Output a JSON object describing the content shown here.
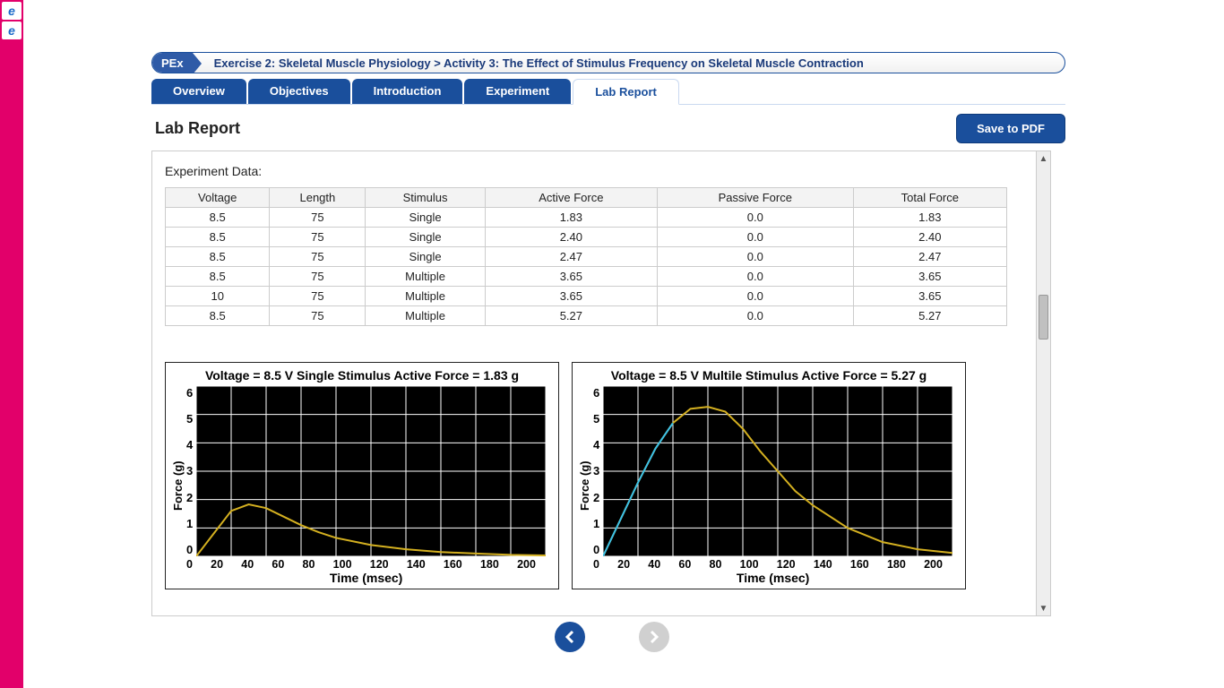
{
  "breadcrumb": {
    "badge": "PEx",
    "text": "Exercise 2: Skeletal Muscle Physiology > Activity 3: The Effect of Stimulus Frequency on Skeletal Muscle Contraction"
  },
  "tabs": {
    "overview": "Overview",
    "objectives": "Objectives",
    "introduction": "Introduction",
    "experiment": "Experiment",
    "labreport": "Lab Report"
  },
  "header": {
    "title": "Lab Report",
    "save_label": "Save to PDF"
  },
  "experiment": {
    "title": "Experiment Data:",
    "columns": [
      "Voltage",
      "Length",
      "Stimulus",
      "Active Force",
      "Passive Force",
      "Total Force"
    ],
    "rows": [
      [
        "8.5",
        "75",
        "Single",
        "1.83",
        "0.0",
        "1.83"
      ],
      [
        "8.5",
        "75",
        "Single",
        "2.40",
        "0.0",
        "2.40"
      ],
      [
        "8.5",
        "75",
        "Single",
        "2.47",
        "0.0",
        "2.47"
      ],
      [
        "8.5",
        "75",
        "Multiple",
        "3.65",
        "0.0",
        "3.65"
      ],
      [
        "10",
        "75",
        "Multiple",
        "3.65",
        "0.0",
        "3.65"
      ],
      [
        "8.5",
        "75",
        "Multiple",
        "5.27",
        "0.0",
        "5.27"
      ]
    ]
  },
  "chart_data": [
    {
      "type": "line",
      "title": "Voltage = 8.5 V Single Stimulus Active Force = 1.83 g",
      "xlabel": "Time (msec)",
      "ylabel": "Force (g)",
      "xlim": [
        0,
        200
      ],
      "ylim": [
        0,
        6
      ],
      "xticks": [
        0,
        20,
        40,
        60,
        80,
        100,
        120,
        140,
        160,
        180,
        200
      ],
      "yticks": [
        0,
        1,
        2,
        3,
        4,
        5,
        6
      ],
      "series": [
        {
          "name": "force",
          "color": "#d4b020",
          "x": [
            0,
            10,
            20,
            30,
            40,
            50,
            60,
            70,
            80,
            100,
            120,
            140,
            160,
            180,
            200
          ],
          "y": [
            0,
            0.8,
            1.6,
            1.83,
            1.7,
            1.4,
            1.1,
            0.85,
            0.65,
            0.4,
            0.25,
            0.15,
            0.1,
            0.05,
            0.03
          ]
        }
      ]
    },
    {
      "type": "line",
      "title": "Voltage = 8.5 V Multile Stimulus Active Force = 5.27 g",
      "xlabel": "Time (msec)",
      "ylabel": "Force (g)",
      "xlim": [
        0,
        200
      ],
      "ylim": [
        0,
        6
      ],
      "xticks": [
        0,
        20,
        40,
        60,
        80,
        100,
        120,
        140,
        160,
        180,
        200
      ],
      "yticks": [
        0,
        1,
        2,
        3,
        4,
        5,
        6
      ],
      "series": [
        {
          "name": "force",
          "color": "#d4b020",
          "x": [
            0,
            10,
            20,
            30,
            40,
            50,
            60,
            70,
            80,
            90,
            100,
            110,
            120,
            140,
            160,
            180,
            200
          ],
          "y": [
            0,
            1.3,
            2.6,
            3.8,
            4.7,
            5.2,
            5.27,
            5.1,
            4.5,
            3.7,
            3.0,
            2.3,
            1.8,
            1.0,
            0.5,
            0.25,
            0.12
          ]
        },
        {
          "name": "stimulus-overlay",
          "color": "#3ac0e8",
          "x": [
            0,
            10,
            20,
            30,
            40
          ],
          "y": [
            0,
            1.3,
            2.6,
            3.8,
            4.7
          ]
        }
      ]
    }
  ]
}
